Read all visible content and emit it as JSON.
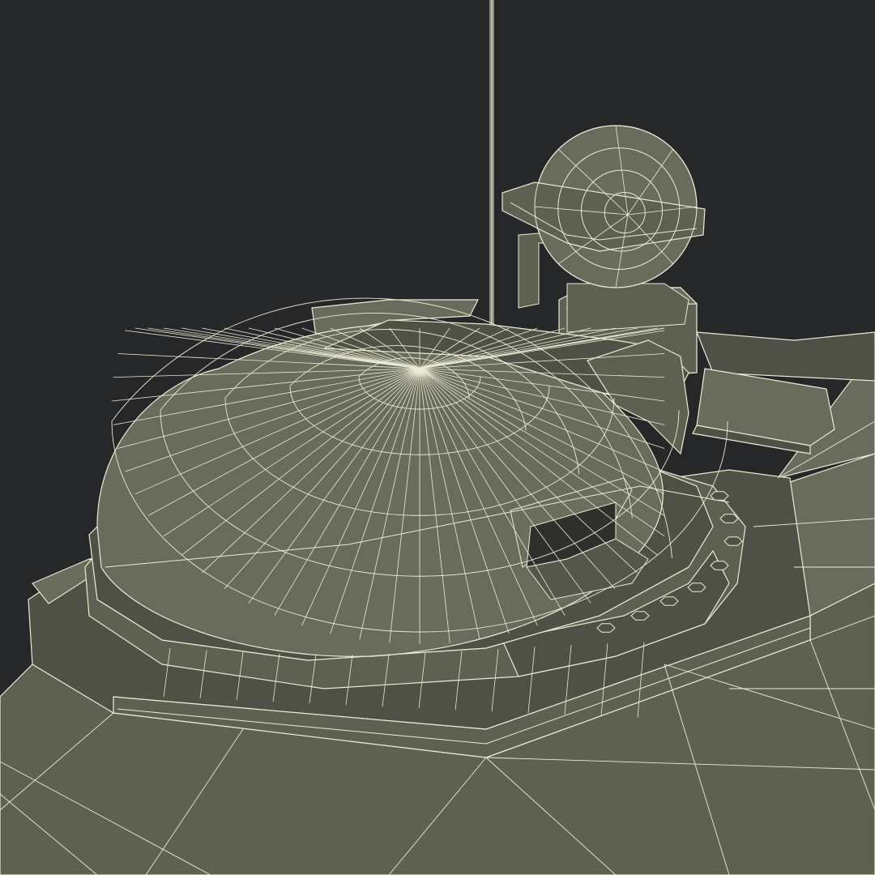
{
  "scene": {
    "subject": "wireframe-render",
    "colors": {
      "background": "#252728",
      "surface": "#5e6052",
      "surface_light": "#696b5c",
      "surface_dark": "#4f5146",
      "wire": "#ecebd5",
      "antenna": "#8a8a7c"
    }
  }
}
